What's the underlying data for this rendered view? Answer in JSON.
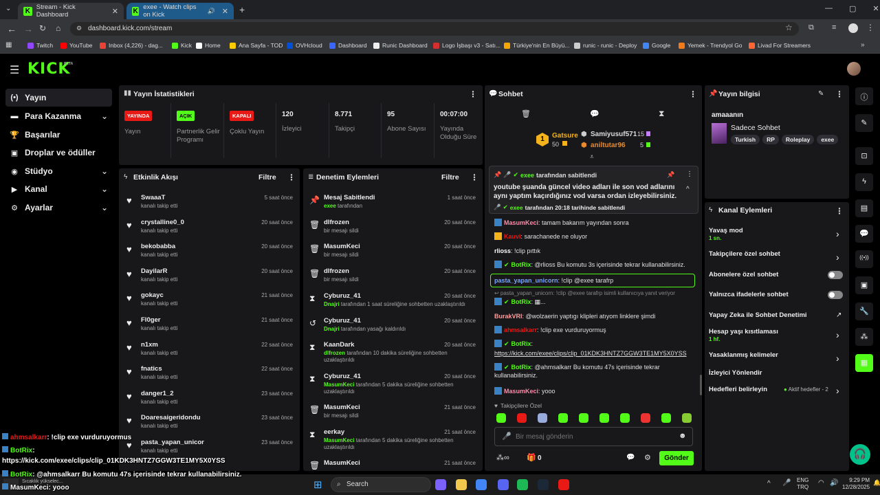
{
  "browser": {
    "tabs": [
      {
        "title": "Stream - Kick Dashboard",
        "close": "✕"
      },
      {
        "title": "exee - Watch clips on Kick",
        "close": "✕"
      }
    ],
    "new_tab": "+",
    "url": "dashboard.kick.com/stream",
    "bookmarks": [
      "Twitch",
      "YouTube",
      "Inbox (4,226) - dag...",
      "Kick",
      "Home",
      "Ana Sayfa - TOD",
      "OVHcloud",
      "Dashboard",
      "Runic Dashboard",
      "Logo İşbaşı v3 - Satı...",
      "Türkiye'nin En Büyü...",
      "runic - runic - Deploy",
      "Google",
      "Yemek - Trendyol Go",
      "Livad For Streamers"
    ]
  },
  "kick": {
    "logo": "KICK",
    "beta": "BETA"
  },
  "sidebar": [
    {
      "label": "Yayın",
      "icon": "broadcast-icon",
      "glyph": "(•)"
    },
    {
      "label": "Para Kazanma",
      "icon": "money-icon",
      "glyph": "▬",
      "chev": "⌄"
    },
    {
      "label": "Başarılar",
      "icon": "trophy-icon",
      "glyph": "🏆"
    },
    {
      "label": "Droplar ve ödüller",
      "icon": "gift-icon",
      "glyph": "▣"
    },
    {
      "label": "Stüdyo",
      "icon": "studio-icon",
      "glyph": "◉",
      "chev": "⌄"
    },
    {
      "label": "Kanal",
      "icon": "channel-icon",
      "glyph": "▶",
      "chev": "⌄"
    },
    {
      "label": "Ayarlar",
      "icon": "settings-icon",
      "glyph": "⚙",
      "chev": "⌄"
    }
  ],
  "stats": {
    "title": "Yayın İstatistikleri",
    "items": [
      {
        "badge": "YAYINDA",
        "label": "Yayın",
        "color": "#e91916"
      },
      {
        "badge": "AÇIK",
        "label": "Partnerlik Gelir Programı",
        "color": "#53fc18"
      },
      {
        "badge": "KAPALI",
        "label": "Çoklu Yayın",
        "color": "#e91916"
      },
      {
        "value": "120",
        "label": "İzleyici"
      },
      {
        "value": "8.771",
        "label": "Takipçi"
      },
      {
        "value": "95",
        "label": "Abone Sayısı"
      },
      {
        "value": "00:07:00",
        "label": "Yayında Olduğu Süre"
      }
    ]
  },
  "activity": {
    "title": "Etkinlik Akışı",
    "filter": "Filtre",
    "rows": [
      {
        "name": "SwaaaT",
        "sub": "kanalı takip etti",
        "time": "5 saat önce"
      },
      {
        "name": "crystalline0_0",
        "sub": "kanalı takip etti",
        "time": "20 saat önce"
      },
      {
        "name": "bekobabba",
        "sub": "kanalı takip etti",
        "time": "20 saat önce"
      },
      {
        "name": "DayilarR",
        "sub": "kanalı takip etti",
        "time": "20 saat önce"
      },
      {
        "name": "gokayc",
        "sub": "kanalı takip etti",
        "time": "21 saat önce"
      },
      {
        "name": "Fl0ger",
        "sub": "kanalı takip etti",
        "time": "21 saat önce"
      },
      {
        "name": "n1xm",
        "sub": "kanalı takip etti",
        "time": "22 saat önce"
      },
      {
        "name": "fnatics",
        "sub": "kanalı takip etti",
        "time": "22 saat önce"
      },
      {
        "name": "danger1_2",
        "sub": "kanalı takip etti",
        "time": "23 saat önce"
      },
      {
        "name": "Doaresaigeridondu",
        "sub": "kanalı takip etti",
        "time": "23 saat önce"
      },
      {
        "name": "pasta_yapan_unicor",
        "sub": "kanalı takip etti",
        "time": "23 saat önce"
      }
    ]
  },
  "moderation": {
    "title": "Denetim Eylemleri",
    "filter": "Filtre",
    "rows": [
      {
        "icon": "pin-icon",
        "glyph": "📌",
        "name": "Mesaj Sabitlendi",
        "who": "exee",
        "sub": " tarafından",
        "time": "1 saat önce"
      },
      {
        "icon": "trash-icon",
        "glyph": "🗑",
        "name": "dlfrozen",
        "who": "",
        "sub": "bir mesajı sildi",
        "time": "20 saat önce"
      },
      {
        "icon": "trash-icon",
        "glyph": "🗑",
        "name": "MasumKeci",
        "who": "",
        "sub": "bir mesajı sildi",
        "time": "20 saat önce"
      },
      {
        "icon": "trash-icon",
        "glyph": "🗑",
        "name": "dlfrozen",
        "who": "",
        "sub": "bir mesajı sildi",
        "time": "20 saat önce"
      },
      {
        "icon": "hourglass-icon",
        "glyph": "⧗",
        "name": "Cyburuz_41",
        "who": "Dnajri",
        "sub": " tarafından 1 saat süreliğine sohbetten uzaklaştırıldı",
        "time": "20 saat önce"
      },
      {
        "icon": "undo-icon",
        "glyph": "↺",
        "name": "Cyburuz_41",
        "who": "Dnajri",
        "sub": " tarafından yasağı kaldırıldı",
        "time": "20 saat önce"
      },
      {
        "icon": "hourglass-icon",
        "glyph": "⧗",
        "name": "KaanDark",
        "who": "dlfrozen",
        "sub": " tarafından 10 dakika süreliğine sohbetten uzaklaştırıldı",
        "time": "20 saat önce"
      },
      {
        "icon": "hourglass-icon",
        "glyph": "⧗",
        "name": "Cyburuz_41",
        "who": "MasumKeci",
        "sub": " tarafından 5 dakika süreliğine sohbetten uzaklaştırıldı",
        "time": "20 saat önce"
      },
      {
        "icon": "trash-icon",
        "glyph": "🗑",
        "name": "MasumKeci",
        "who": "",
        "sub": "bir mesajı sildi",
        "time": "21 saat önce"
      },
      {
        "icon": "hourglass-icon",
        "glyph": "⧗",
        "name": "eerkay",
        "who": "MasumKeci",
        "sub": " tarafından 5 dakika süreliğine sohbetten uzaklaştırıldı",
        "time": "21 saat önce"
      },
      {
        "icon": "trash-icon",
        "glyph": "🗑",
        "name": "MasumKeci",
        "who": "",
        "sub": "",
        "time": "21 saat önce"
      }
    ]
  },
  "chat": {
    "title": "Sohbet",
    "leaders": {
      "first": "Gatsure",
      "first_count": "50",
      "second": "Samiyusuf571",
      "second_count": "15",
      "third": "aniltutar96",
      "third_count": "5",
      "rank": "1"
    },
    "pinned": {
      "by": "exee",
      "by_suffix": " tarafından sabitlendi",
      "text": "youtube şuanda güncel video adları ile son vod adlarını aynı yaptım kaçırdığınız vod varsa ordan izleyebilirsiniz.",
      "footer_user": "exee",
      "footer": " tarafından 20:18 tarihinde sabitlendi"
    },
    "messages": [
      {
        "user": "MasumKeci",
        "color": "#ff8aa8",
        "text": ": tamam bakarım yayından sonra"
      },
      {
        "user": "Kauvi",
        "color": "#e91916",
        "text": ": sarachanede ne oluyor"
      },
      {
        "user": "rlioss",
        "color": "#ffffff",
        "text": ": !clip pıttık"
      },
      {
        "user": "BotRix",
        "color": "#53fc18",
        "text": ": @rlioss Bu komutu 3s içerisinde tekrar kullanabilirsiniz."
      },
      {
        "user": "pasta_yapan_unicorn",
        "color": "#7aa7ff",
        "text": ": !clip @exee tarafrp",
        "highlight": true
      },
      {
        "user": "",
        "color": "#888",
        "text": "↩ pasta_yapan_unicorn: !clip @exee tarafrp isimli kullanıcıya yanıt veriyor",
        "reply": true
      },
      {
        "user": "BotRix",
        "color": "#53fc18",
        "text": ": ▦..."
      },
      {
        "user": "BurakVRI",
        "color": "#ff9e9e",
        "text": ": @wolzaerin yaptıgı klipleri atıyom linklere şimdi"
      },
      {
        "user": "ahmsalkarr",
        "color": "#e91916",
        "text": ": !clip exe vurduruyormuş"
      },
      {
        "user": "BotRix",
        "color": "#53fc18",
        "text": ":"
      },
      {
        "user": "",
        "color": "#e0e0e0",
        "text": "https://kick.com/exee/clips/clip_01KDK3HNTZ7GGW3TE1MY5X0YSS",
        "link": true
      },
      {
        "user": "BotRix",
        "color": "#53fc18",
        "text": ": @ahmsalkarr Bu komutu 47s içerisinde tekrar kullanabilirsiniz."
      },
      {
        "user": "MasumKeci",
        "color": "#ff8aa8",
        "text": ": yooo"
      }
    ],
    "followers_only": "Takipçilere Özel",
    "input_placeholder": "Bir mesaj gönderin",
    "send": "Gönder",
    "points": "0"
  },
  "info": {
    "title": "Yayın bilgisi",
    "stream_title": "amaaanın",
    "category": "Sadece Sohbet",
    "tags": [
      "Turkish",
      "RP",
      "Roleplay",
      "exee"
    ]
  },
  "channel_actions": {
    "title": "Kanal Eylemleri",
    "items": [
      {
        "label": "Yavaş mod",
        "sub": "1 sn.",
        "type": "chev"
      },
      {
        "label": "Takipçilere özel sohbet",
        "type": "chev"
      },
      {
        "label": "Abonelere özel sohbet",
        "type": "toggle"
      },
      {
        "label": "Yalnızca ifadelerle sohbet",
        "type": "toggle"
      },
      {
        "label": "Yapay Zeka ile Sohbet Denetimi",
        "type": "ext"
      },
      {
        "label": "Hesap yaşı kısıtlaması",
        "sub": "1 hf.",
        "type": "chev"
      },
      {
        "label": "Yasaklanmış kelimeler",
        "type": "chev"
      },
      {
        "label": "İzleyici Yönlendir",
        "type": "none"
      },
      {
        "label": "Hedefleri belirleyin",
        "type": "goal",
        "goal": "Aktif hedefler - 2"
      }
    ]
  },
  "overlay": [
    {
      "user": "ahmsalkarr",
      "color": "#e91916",
      "text": ": !clip exe vurduruyormus"
    },
    {
      "user": "BotRix",
      "color": "#53fc18",
      "text": ":"
    },
    {
      "user": "",
      "color": "#fff",
      "text": "https://kick.com/exee/clips/clip_01KDK3HNTZ7GGW3TE1MY5X0YSS"
    },
    {
      "user": "BotRix",
      "color": "#53fc18",
      "text": ": @ahmsalkarr Bu komutu 47s içerisinde tekrar kullanabilirsiniz."
    },
    {
      "user": "MasumKeci",
      "color": "#fff",
      "text": ": yooo"
    }
  ],
  "taskbar": {
    "weather": "Sıcaklık yükselec...",
    "search": "Search",
    "lang": "ENG",
    "lang2": "TRQ",
    "time": "9:29 PM",
    "date": "12/28/2025"
  }
}
